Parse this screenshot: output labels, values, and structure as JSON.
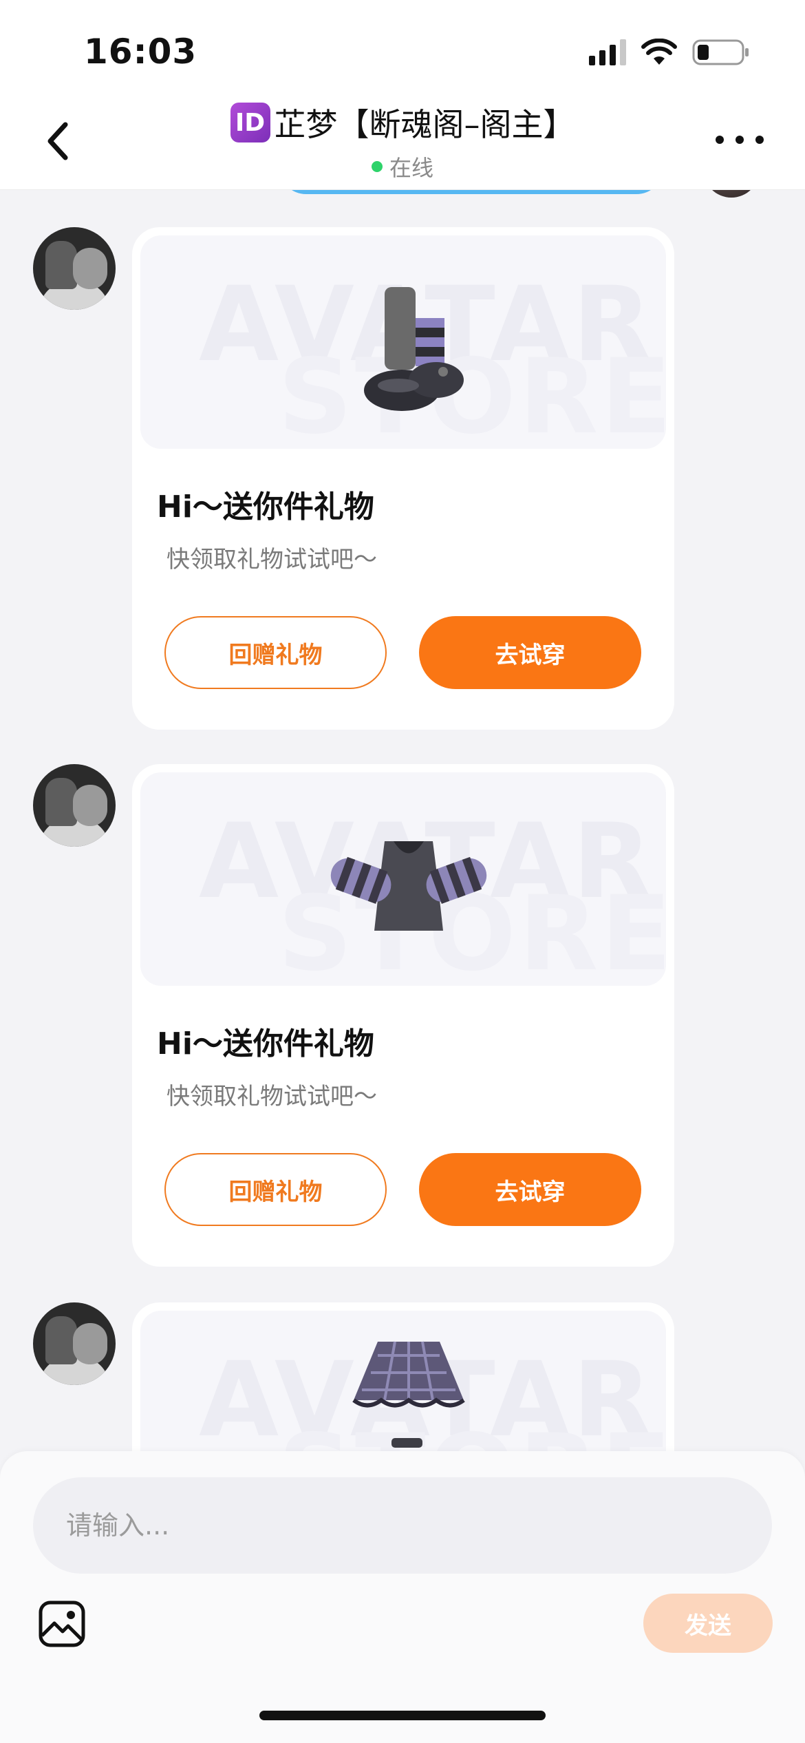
{
  "status_bar": {
    "time": "16:03"
  },
  "header": {
    "id_badge": "ID",
    "title": "芷梦【断魂阁–阁主】",
    "online_status": "在线"
  },
  "messages": [
    {
      "title": "Hi～送你件礼物",
      "subtitle": "快领取礼物试试吧～",
      "return_gift_label": "回赠礼物",
      "try_on_label": "去试穿",
      "watermark_top": "AVATAR",
      "watermark_bottom": "STORE",
      "item_icon": "boots-icon"
    },
    {
      "title": "Hi～送你件礼物",
      "subtitle": "快领取礼物试试吧～",
      "return_gift_label": "回赠礼物",
      "try_on_label": "去试穿",
      "watermark_top": "AVATAR",
      "watermark_bottom": "STORE",
      "item_icon": "sweater-icon"
    },
    {
      "watermark_top": "AVATAR",
      "watermark_bottom": "STORE",
      "item_icon": "skirt-icon"
    }
  ],
  "composer": {
    "placeholder": "请输入...",
    "send_label": "发送"
  },
  "colors": {
    "accent": "#fa7614",
    "send_disabled": "#fcd6bd",
    "online": "#2ed36a"
  }
}
